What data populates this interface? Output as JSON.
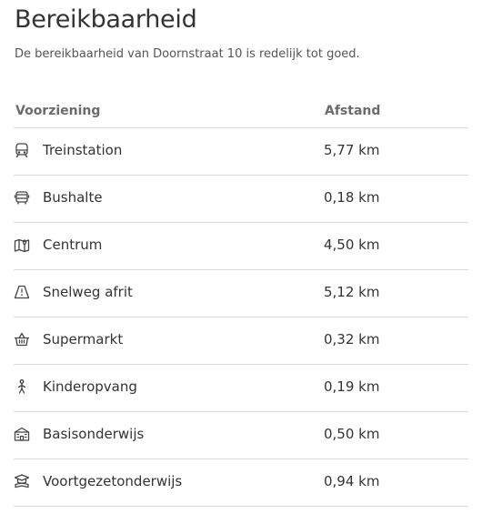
{
  "header": {
    "title": "Bereikbaarheid",
    "subtitle": "De bereikbaarheid van Doornstraat 10 is redelijk tot goed."
  },
  "table": {
    "columns": {
      "name": "Voorziening",
      "distance": "Afstand"
    },
    "rows": [
      {
        "icon": "train-icon",
        "name": "Treinstation",
        "distance": "5,77 km"
      },
      {
        "icon": "bus-icon",
        "name": "Bushalte",
        "distance": "0,18 km"
      },
      {
        "icon": "map-icon",
        "name": "Centrum",
        "distance": "4,50 km"
      },
      {
        "icon": "highway-icon",
        "name": "Snelweg afrit",
        "distance": "5,12 km"
      },
      {
        "icon": "basket-icon",
        "name": "Supermarkt",
        "distance": "0,32 km"
      },
      {
        "icon": "child-icon",
        "name": "Kinderopvang",
        "distance": "0,19 km"
      },
      {
        "icon": "school-icon",
        "name": "Basisonderwijs",
        "distance": "0,50 km"
      },
      {
        "icon": "graduation-icon",
        "name": "Voortgezetonderwijs",
        "distance": "0,94 km"
      }
    ]
  }
}
